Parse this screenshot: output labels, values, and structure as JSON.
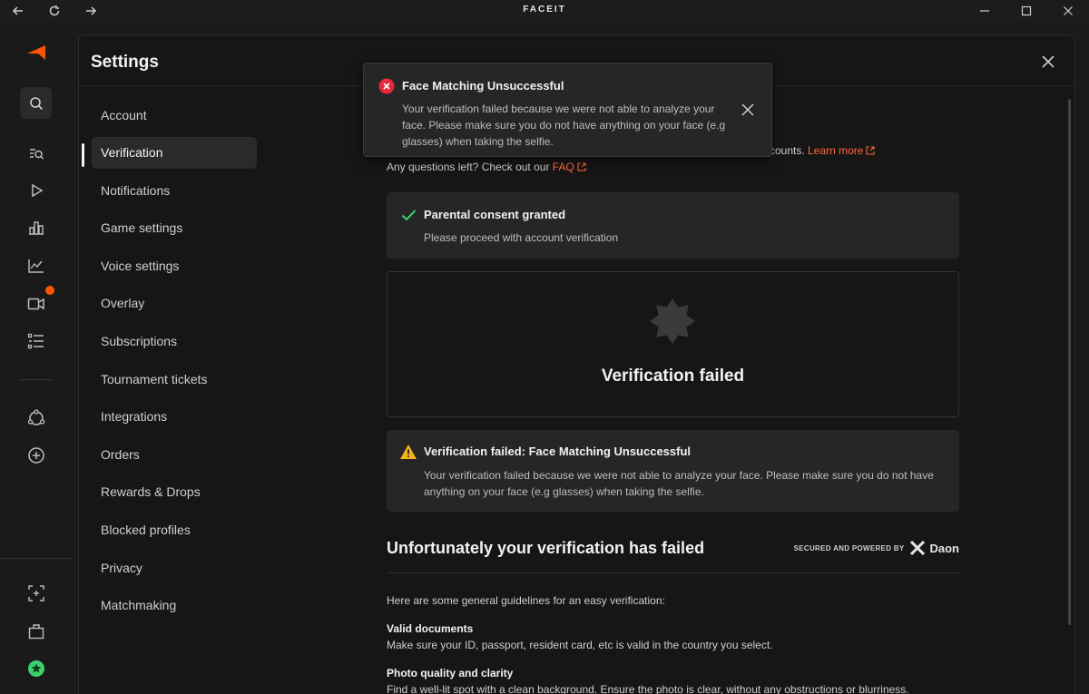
{
  "app": {
    "brand": "FACEIT"
  },
  "settings": {
    "title": "Settings",
    "menu": [
      "Account",
      "Verification",
      "Notifications",
      "Game settings",
      "Voice settings",
      "Overlay",
      "Subscriptions",
      "Tournament tickets",
      "Integrations",
      "Orders",
      "Rewards & Drops",
      "Blocked profiles",
      "Privacy",
      "Matchmaking"
    ],
    "active_item": "Verification"
  },
  "toast": {
    "title": "Face Matching Unsuccessful",
    "message": "Your verification failed because we were not able to analyze your face. Please make sure you do not have anything on your face (e.g glasses) when taking the selfie."
  },
  "intro": {
    "line1_tail": "counts.",
    "learn_more": "Learn more",
    "questions": "Any questions left? Check out our ",
    "faq": "FAQ"
  },
  "consent": {
    "title": "Parental consent granted",
    "text": "Please proceed with account verification"
  },
  "status": {
    "title": "Verification failed"
  },
  "warning": {
    "title": "Verification failed: Face Matching Unsuccessful",
    "text": "Your verification failed because we were not able to analyze your face. Please make sure you do not have anything on your face (e.g glasses) when taking the selfie."
  },
  "failed_section": {
    "title": "Unfortunately your verification has failed",
    "secured": "SECURED AND POWERED BY",
    "provider": "Daon"
  },
  "guidelines": {
    "intro": "Here are some general guidelines for an easy verification:",
    "items": [
      {
        "title": "Valid documents",
        "text": "Make sure your ID, passport, resident card, etc is valid in the country you select."
      },
      {
        "title": "Photo quality and clarity",
        "text": "Find a well-lit spot with a clean background. Ensure the photo is clear, without any obstructions or blurriness."
      }
    ]
  },
  "colors": {
    "accent": "#ff5500",
    "link": "#ff6a3d",
    "success": "#3dd16b",
    "warning": "#f5b41a",
    "error": "#e5283a"
  }
}
